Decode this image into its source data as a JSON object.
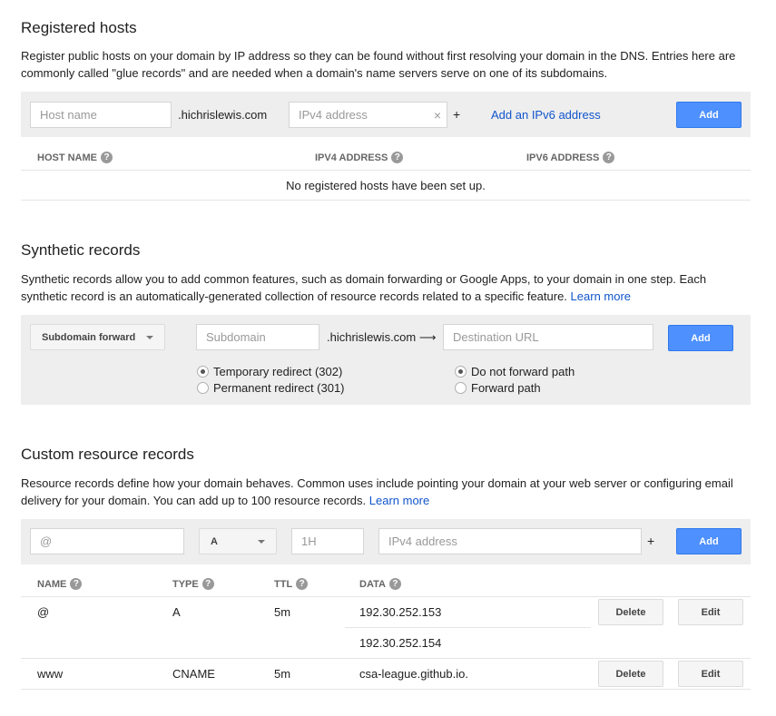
{
  "registered_hosts": {
    "title": "Registered hosts",
    "description": "Register public hosts on your domain by IP address so they can be found without first resolving your domain in the DNS. Entries here are commonly called \"glue records\" and are needed when a domain's name servers serve on one of its subdomains.",
    "host_placeholder": "Host name",
    "domain_suffix": ".hichrislewis.com",
    "ipv4_placeholder": "IPv4 address",
    "clear_glyph": "×",
    "plus": "+",
    "add_ipv6_link": "Add an IPv6 address",
    "add_button": "Add",
    "columns": [
      "HOST NAME",
      "IPV4 ADDRESS",
      "IPV6 ADDRESS"
    ],
    "empty_message": "No registered hosts have been set up."
  },
  "synthetic_records": {
    "title": "Synthetic records",
    "description": "Synthetic records allow you to add common features, such as domain forwarding or Google Apps, to your domain in one step. Each synthetic record is an automatically-generated collection of resource records related to a specific feature.",
    "learn_more": "Learn more",
    "type_selected": "Subdomain forward",
    "subdomain_placeholder": "Subdomain",
    "domain_suffix": ".hichrislewis.com",
    "arrow": "⟶",
    "destination_placeholder": "Destination URL",
    "add_button": "Add",
    "redirect_options": [
      {
        "label": "Temporary redirect (302)",
        "selected": true
      },
      {
        "label": "Permanent redirect (301)",
        "selected": false
      }
    ],
    "path_options": [
      {
        "label": "Do not forward path",
        "selected": true
      },
      {
        "label": "Forward path",
        "selected": false
      }
    ]
  },
  "custom_records": {
    "title": "Custom resource records",
    "description": "Resource records define how your domain behaves. Common uses include pointing your domain at your web server or configuring email delivery for your domain. You can add up to 100 resource records.",
    "learn_more": "Learn more",
    "name_placeholder": "@",
    "type_selected": "A",
    "ttl_placeholder": "1H",
    "data_placeholder": "IPv4 address",
    "plus": "+",
    "add_button": "Add",
    "columns": [
      "NAME",
      "TYPE",
      "TTL",
      "DATA"
    ],
    "rows": [
      {
        "name": "@",
        "type": "A",
        "ttl": "5m",
        "data": [
          "192.30.252.153",
          "192.30.252.154"
        ],
        "delete": "Delete",
        "edit": "Edit"
      },
      {
        "name": "www",
        "type": "CNAME",
        "ttl": "5m",
        "data": [
          "csa-league.github.io."
        ],
        "delete": "Delete",
        "edit": "Edit"
      }
    ]
  },
  "help_glyph": "?",
  "colors": {
    "accent_blue": "#4d90fe",
    "link": "#1155cc",
    "panel": "#eeeeee"
  }
}
